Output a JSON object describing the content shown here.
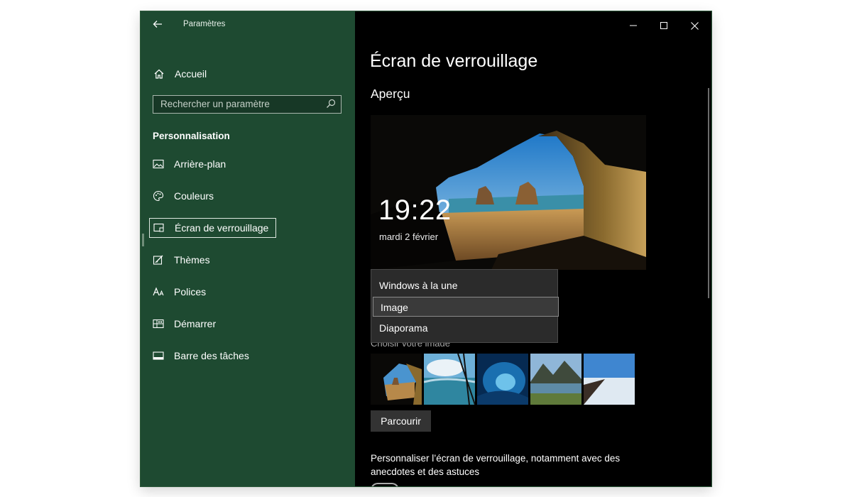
{
  "app": {
    "title": "Paramètres",
    "back_icon": "arrow-left-icon",
    "window_controls": [
      "minimize-icon",
      "maximize-icon",
      "close-icon"
    ]
  },
  "sidebar": {
    "home_label": "Accueil",
    "search_placeholder": "Rechercher un paramètre",
    "section_title": "Personnalisation",
    "items": [
      {
        "label": "Arrière-plan",
        "icon": "picture-icon"
      },
      {
        "label": "Couleurs",
        "icon": "palette-icon"
      },
      {
        "label": "Écran de verrouillage",
        "icon": "lock-screen-icon",
        "selected": true
      },
      {
        "label": "Thèmes",
        "icon": "brush-icon"
      },
      {
        "label": "Polices",
        "icon": "font-icon"
      },
      {
        "label": "Démarrer",
        "icon": "start-grid-icon"
      },
      {
        "label": "Barre des tâches",
        "icon": "taskbar-icon"
      }
    ]
  },
  "main": {
    "title": "Écran de verrouillage",
    "preview_label": "Aperçu",
    "lock_time": "19:22",
    "lock_date": "mardi 2 février",
    "background_dropdown": {
      "options": [
        "Windows à la une",
        "Image",
        "Diaporama"
      ],
      "highlighted": "Image"
    },
    "choose_picture_label": "Choisir votre image",
    "browse_button": "Parcourir",
    "fun_facts_text": "Personnaliser l’écran de verrouillage, notamment avec des anecdotes et des astuces"
  },
  "colors": {
    "sidebar_bg": "#1e4a31",
    "main_bg": "#000000",
    "accent_line": "#2e7d4a"
  }
}
